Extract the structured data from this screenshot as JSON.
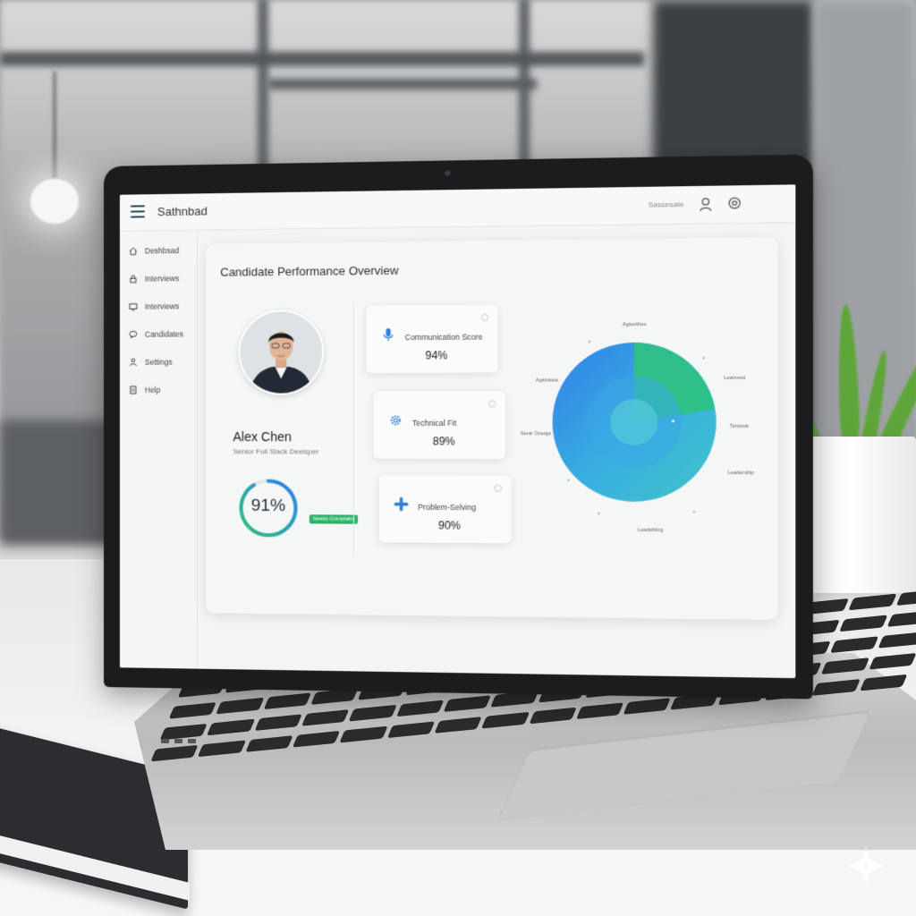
{
  "app": {
    "title": "Sathnbad"
  },
  "topbar": {
    "link_label": "Sassesate",
    "user_icon": "user-icon",
    "settings_icon": "settings-icon"
  },
  "sidebar": {
    "items": [
      {
        "label": "Deshbsad",
        "icon": "home-icon"
      },
      {
        "label": "Interviews",
        "icon": "lock-icon"
      },
      {
        "label": "Interviews",
        "icon": "monitor-icon"
      },
      {
        "label": "Candidates",
        "icon": "chat-icon"
      },
      {
        "label": "Settings",
        "icon": "people-icon"
      },
      {
        "label": "Help",
        "icon": "document-icon"
      }
    ]
  },
  "main": {
    "title": "Candidate Performance Overview",
    "candidate": {
      "name": "Alex Chen",
      "role": "Senior Full Slack Deelsper",
      "overall_score_label": "91%",
      "overall_score": 0.91,
      "status": "Sestio Complaint"
    },
    "metrics": [
      {
        "label": "Communication Score",
        "value": "94%",
        "icon": "microphone-icon",
        "color": "#2f7fd8"
      },
      {
        "label": "Technical Fit",
        "value": "89%",
        "icon": "gear-icon",
        "color": "#2f7fd8"
      },
      {
        "label": "Problem-Selving",
        "value": "90%",
        "icon": "plus-icon",
        "color": "#2f7fd8"
      }
    ]
  },
  "chart_data": {
    "type": "pie",
    "axis_labels": [
      "Agsortfres",
      "Leanvest",
      "Tentrrek",
      "Leadership",
      "Leadsbilng",
      "Agsinisea",
      "Sentr Oxergs"
    ],
    "colors": [
      "#2ec27e",
      "#2f80ed",
      "#4cc3d9"
    ]
  },
  "colors": {
    "accent": "#2f7fd8",
    "success": "#2eb36a",
    "text": "#2f3133"
  }
}
